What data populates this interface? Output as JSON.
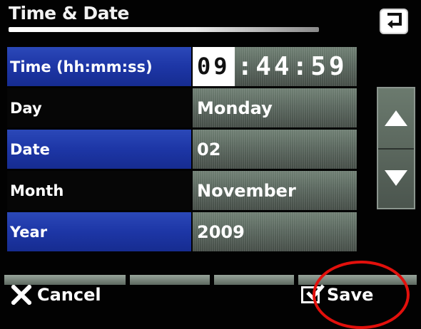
{
  "header": {
    "title": "Time & Date"
  },
  "rows": [
    {
      "label": "Time (hh:mm:ss)",
      "value_hh": "09",
      "value_rest": ":44:59"
    },
    {
      "label": "Day",
      "value": "Monday"
    },
    {
      "label": "Date",
      "value": "02"
    },
    {
      "label": "Month",
      "value": "November"
    },
    {
      "label": "Year",
      "value": "2009"
    }
  ],
  "footer": {
    "cancel_label": "Cancel",
    "save_label": "Save"
  },
  "colors": {
    "selected_row": "#1d36a6",
    "highlight_circle": "#e2100c"
  }
}
